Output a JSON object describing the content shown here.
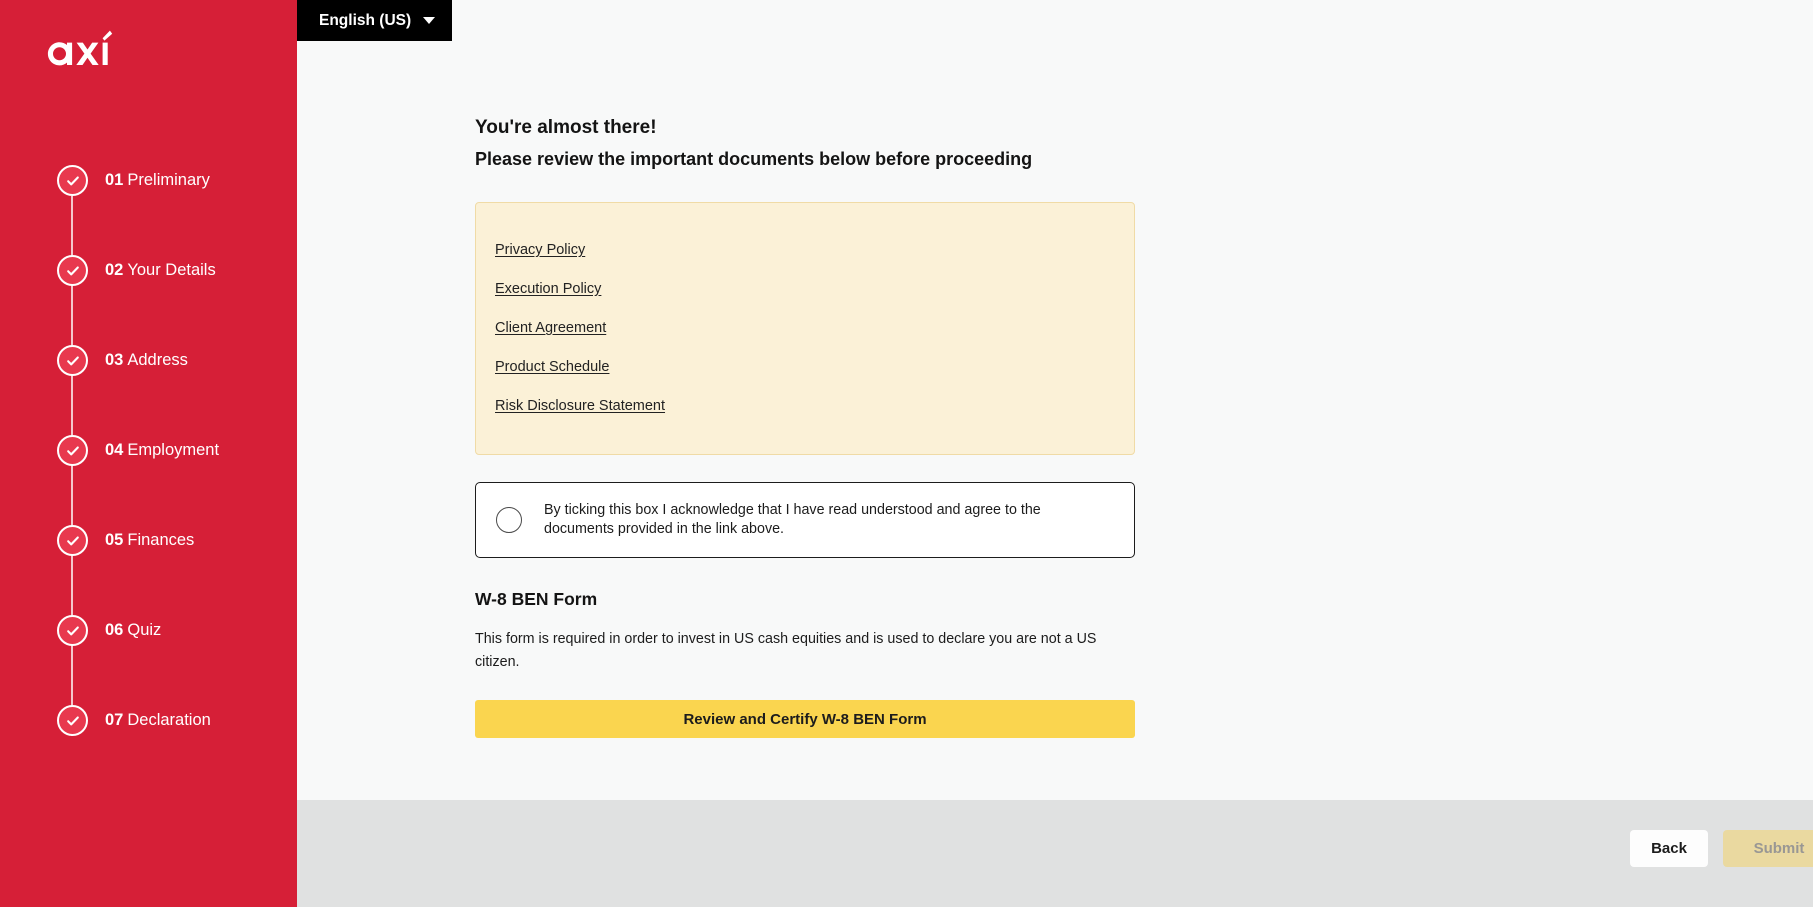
{
  "brand": {
    "logo_text": "axi",
    "sidebar_color": "#d61f37",
    "accent_yellow": "#fad54f",
    "panel_yellow": "#fbf1d7"
  },
  "language_selector": {
    "label": "English (US)",
    "caret_icon": "chevron-down-icon"
  },
  "sidebar": {
    "steps": [
      {
        "number": "01",
        "label": "Preliminary",
        "state": "completed"
      },
      {
        "number": "02",
        "label": "Your Details",
        "state": "completed"
      },
      {
        "number": "03",
        "label": "Address",
        "state": "completed"
      },
      {
        "number": "04",
        "label": "Employment",
        "state": "completed"
      },
      {
        "number": "05",
        "label": "Finances",
        "state": "completed"
      },
      {
        "number": "06",
        "label": "Quiz",
        "state": "completed"
      },
      {
        "number": "07",
        "label": "Declaration",
        "state": "completed"
      }
    ]
  },
  "main": {
    "headline": "You're almost there!",
    "subheadline": "Please review the important documents below before proceeding",
    "documents": [
      {
        "label": "Privacy Policy"
      },
      {
        "label": "Execution Policy"
      },
      {
        "label": "Client Agreement"
      },
      {
        "label": "Product Schedule"
      },
      {
        "label": "Risk Disclosure Statement"
      }
    ],
    "consent": {
      "text": "By ticking this box I acknowledge that I have read understood and agree to the documents provided in the link above.",
      "checked": false
    },
    "w8_section": {
      "title": "W-8 BEN Form",
      "description": "This form is required in order to invest in US cash equities and is used to declare you are not a US citizen.",
      "button_label": "Review and Certify W-8 BEN Form"
    }
  },
  "footer": {
    "back_label": "Back",
    "submit_label": "Submit",
    "submit_disabled": true
  }
}
